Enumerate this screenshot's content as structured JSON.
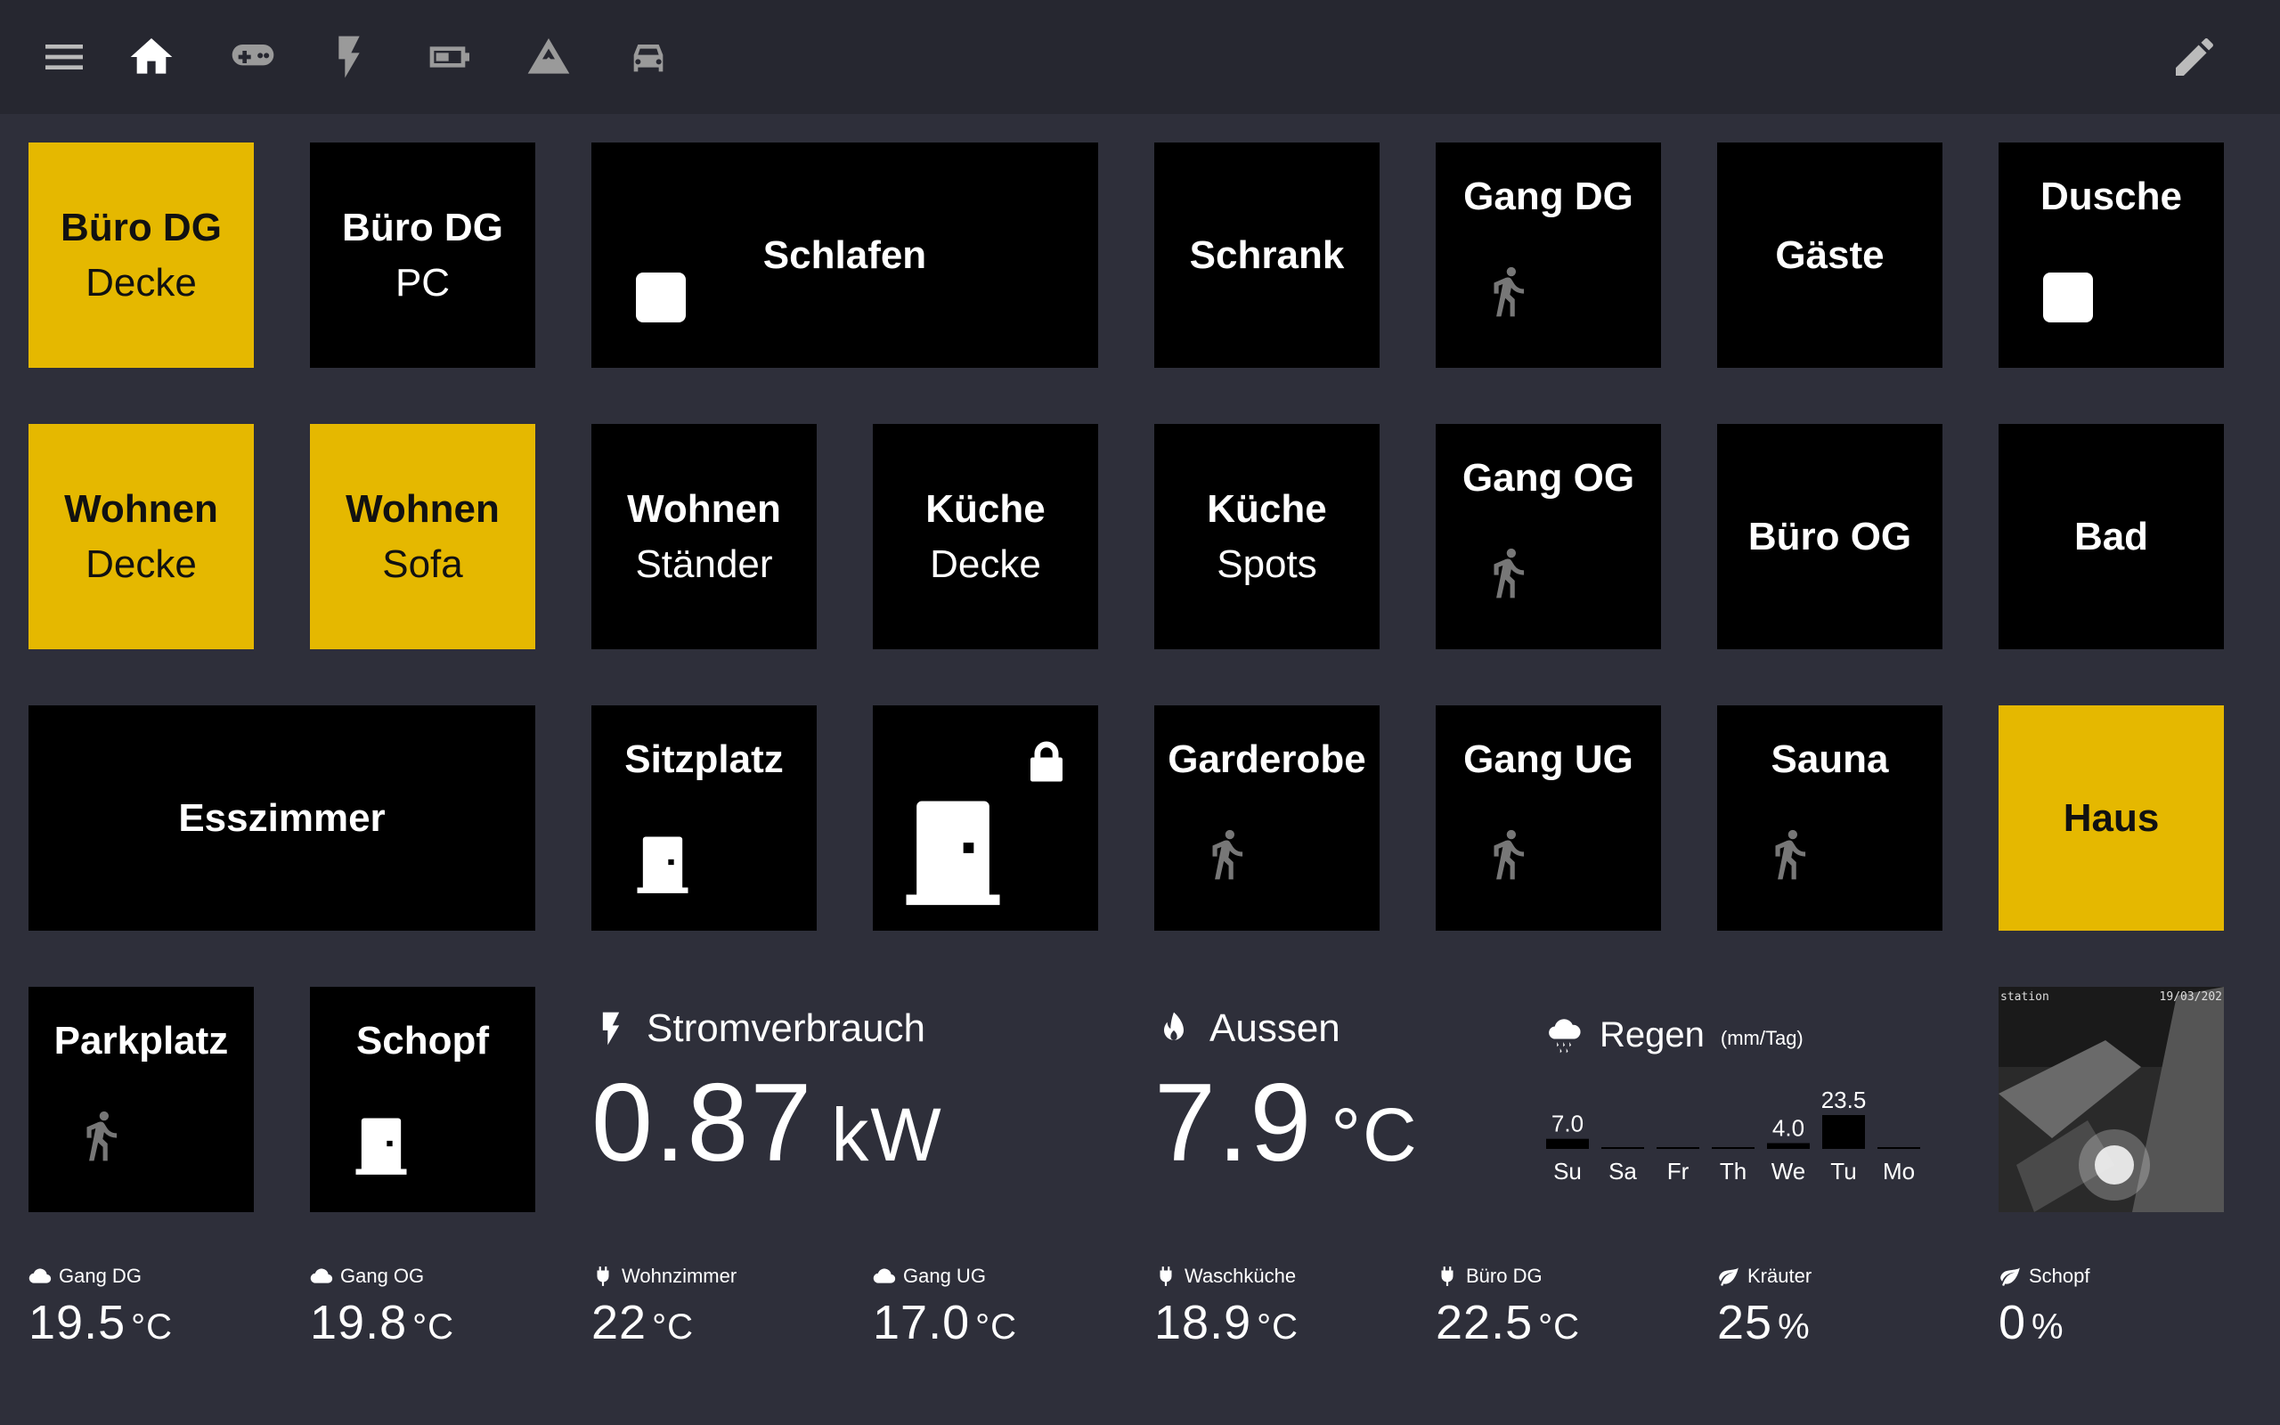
{
  "toolbar": {
    "icons": [
      "menu-icon",
      "home-icon",
      "gamepad-icon",
      "lightning-icon",
      "battery-icon",
      "mountain-icon",
      "car-icon"
    ],
    "edit_icon": "pencil-icon"
  },
  "tiles": {
    "buero_dg_decke": {
      "l1": "Büro DG",
      "l2": "Decke"
    },
    "buero_dg_pc": {
      "l1": "Büro DG",
      "l2": "PC"
    },
    "schlafen": {
      "l1": "Schlafen"
    },
    "schrank": {
      "l1": "Schrank"
    },
    "gang_dg": {
      "l1": "Gang DG"
    },
    "gaeste": {
      "l1": "Gäste"
    },
    "dusche": {
      "l1": "Dusche"
    },
    "wohnen_decke": {
      "l1": "Wohnen",
      "l2": "Decke"
    },
    "wohnen_sofa": {
      "l1": "Wohnen",
      "l2": "Sofa"
    },
    "wohnen_staender": {
      "l1": "Wohnen",
      "l2": "Ständer"
    },
    "kueche_decke": {
      "l1": "Küche",
      "l2": "Decke"
    },
    "kueche_spots": {
      "l1": "Küche",
      "l2": "Spots"
    },
    "gang_og": {
      "l1": "Gang OG"
    },
    "buero_og": {
      "l1": "Büro OG"
    },
    "bad": {
      "l1": "Bad"
    },
    "esszimmer": {
      "l1": "Esszimmer"
    },
    "sitzplatz": {
      "l1": "Sitzplatz"
    },
    "garderobe": {
      "l1": "Garderobe"
    },
    "gang_ug": {
      "l1": "Gang UG"
    },
    "sauna": {
      "l1": "Sauna"
    },
    "haus": {
      "l1": "Haus"
    },
    "parkplatz": {
      "l1": "Parkplatz"
    },
    "schopf": {
      "l1": "Schopf"
    }
  },
  "power": {
    "title": "Stromverbrauch",
    "value": "0.87",
    "unit": "kW"
  },
  "outside": {
    "title": "Aussen",
    "value": "7.9",
    "unit": "°C"
  },
  "rain": {
    "title": "Regen",
    "unit": "(mm/Tag)",
    "chart_data": {
      "type": "bar",
      "categories": [
        "Su",
        "Sa",
        "Fr",
        "Th",
        "We",
        "Tu",
        "Mo"
      ],
      "values": [
        7.0,
        0,
        0,
        0,
        4.0,
        23.5,
        0
      ],
      "labels": [
        "7.0",
        "",
        "",
        "",
        "4.0",
        "23.5",
        ""
      ]
    }
  },
  "camera": {
    "overlay_left": "station",
    "overlay_right": "19/03/202"
  },
  "sensors": [
    {
      "name": "Gang DG",
      "icon": "cloud-icon",
      "value": "19.5",
      "unit": "°C"
    },
    {
      "name": "Gang OG",
      "icon": "cloud-icon",
      "value": "19.8",
      "unit": "°C"
    },
    {
      "name": "Wohnzimmer",
      "icon": "plug-icon",
      "value": "22",
      "unit": "°C"
    },
    {
      "name": "Gang UG",
      "icon": "cloud-icon",
      "value": "17.0",
      "unit": "°C"
    },
    {
      "name": "Waschküche",
      "icon": "plug-icon",
      "value": "18.9",
      "unit": "°C"
    },
    {
      "name": "Büro DG",
      "icon": "plug-icon",
      "value": "22.5",
      "unit": "°C"
    },
    {
      "name": "Kräuter",
      "icon": "leaf-icon",
      "value": "25",
      "unit": "%"
    },
    {
      "name": "Schopf",
      "icon": "leaf-icon",
      "value": "0",
      "unit": "%"
    }
  ],
  "colors": {
    "on": "#e5b800",
    "off": "#000000",
    "bg": "#2e2f3a",
    "bar": "#262730"
  }
}
